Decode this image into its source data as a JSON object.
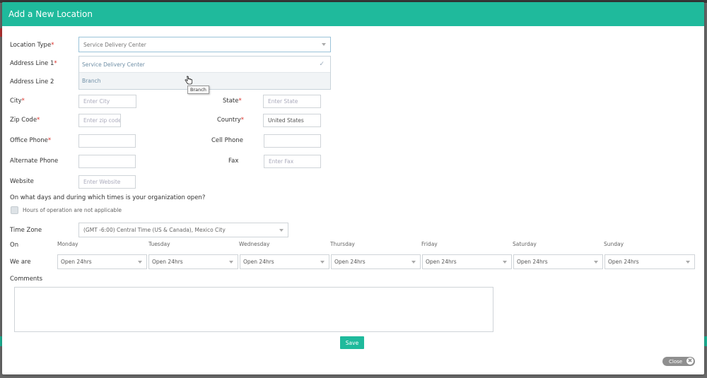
{
  "modal": {
    "title": "Add a New Location"
  },
  "location_type": {
    "label": "Location Type",
    "required_mark": "*",
    "selected": "Service Delivery Center",
    "options": [
      "Service Delivery Center",
      "Branch"
    ],
    "tooltip": "Branch"
  },
  "address1": {
    "label": "Address Line 1",
    "required_mark": "*"
  },
  "address2": {
    "label": "Address Line 2"
  },
  "city": {
    "label": "City",
    "required_mark": "*",
    "placeholder": "Enter City"
  },
  "state": {
    "label": "State",
    "required_mark": "*",
    "placeholder": "Enter State"
  },
  "zip": {
    "label": "Zip Code",
    "required_mark": "*",
    "placeholder": "Enter zip code"
  },
  "country": {
    "label": "Country",
    "required_mark": "*",
    "value": "United States"
  },
  "office_phone": {
    "label": "Office Phone",
    "required_mark": "*"
  },
  "cell_phone": {
    "label": "Cell Phone"
  },
  "alt_phone": {
    "label": "Alternate Phone"
  },
  "fax": {
    "label": "Fax",
    "placeholder": "Enter Fax"
  },
  "website": {
    "label": "Website",
    "placeholder": "Enter Website"
  },
  "hours": {
    "question": "On what days and during which times is your organization open?",
    "na_label": "Hours of operation are not applicable",
    "tz_label": "Time Zone",
    "tz_value": "(GMT -6:00) Central Time (US & Canada), Mexico City",
    "on_label": "On",
    "we_are_label": "We are",
    "days": [
      "Monday",
      "Tuesday",
      "Wednesday",
      "Thursday",
      "Friday",
      "Saturday",
      "Sunday"
    ],
    "values": [
      "Open 24hrs",
      "Open 24hrs",
      "Open 24hrs",
      "Open 24hrs",
      "Open 24hrs",
      "Open 24hrs",
      "Open 24hrs"
    ]
  },
  "comments": {
    "label": "Comments"
  },
  "actions": {
    "save": "Save",
    "close": "Close",
    "close_icon": "✖"
  },
  "colors": {
    "accent": "#1fba9c",
    "required": "#d9302a"
  }
}
